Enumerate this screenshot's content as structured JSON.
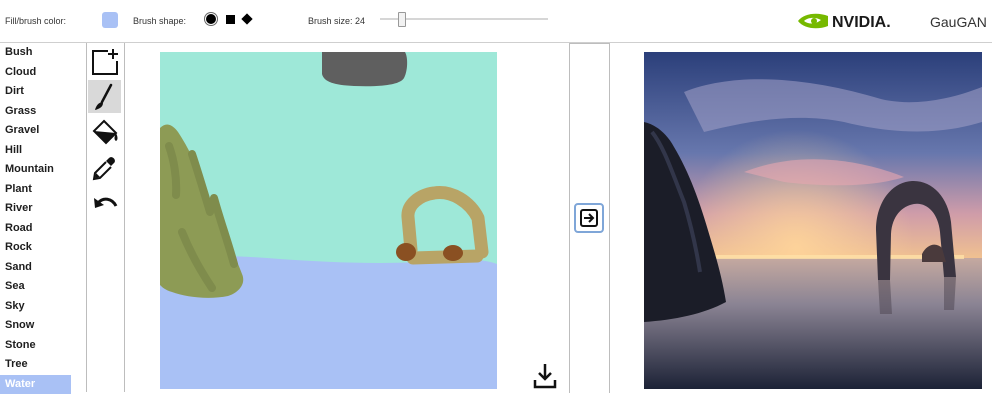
{
  "toolbar": {
    "fill_label": "Fill/brush color:",
    "fill_color": "#a9c1f5",
    "brush_shape_label": "Brush shape:",
    "brush_shapes": [
      "circle",
      "square",
      "diamond"
    ],
    "brush_size_label": "Brush size: 24",
    "brush_size_value": 24
  },
  "brand": {
    "logo_text": "NVIDIA.",
    "logo_color": "#76b900",
    "app_name": "GauGAN"
  },
  "labels": [
    "Bush",
    "Cloud",
    "Dirt",
    "Grass",
    "Gravel",
    "Hill",
    "Mountain",
    "Plant",
    "River",
    "Road",
    "Rock",
    "Sand",
    "Sea",
    "Sky",
    "Snow",
    "Stone",
    "Tree",
    "Water"
  ],
  "selected_label": "Water",
  "tools": [
    "new-canvas-icon",
    "brush-icon",
    "fill-bucket-icon",
    "eyedropper-icon",
    "undo-icon"
  ],
  "active_tool": "brush-icon",
  "segmentation_colors": {
    "sky": "#9ee8d8",
    "water": "#a9c1f5",
    "grass": "#8d9b55",
    "cloud": "#5f5f5f",
    "rock_arch": "#b8a466",
    "stone": "#8a5022"
  }
}
